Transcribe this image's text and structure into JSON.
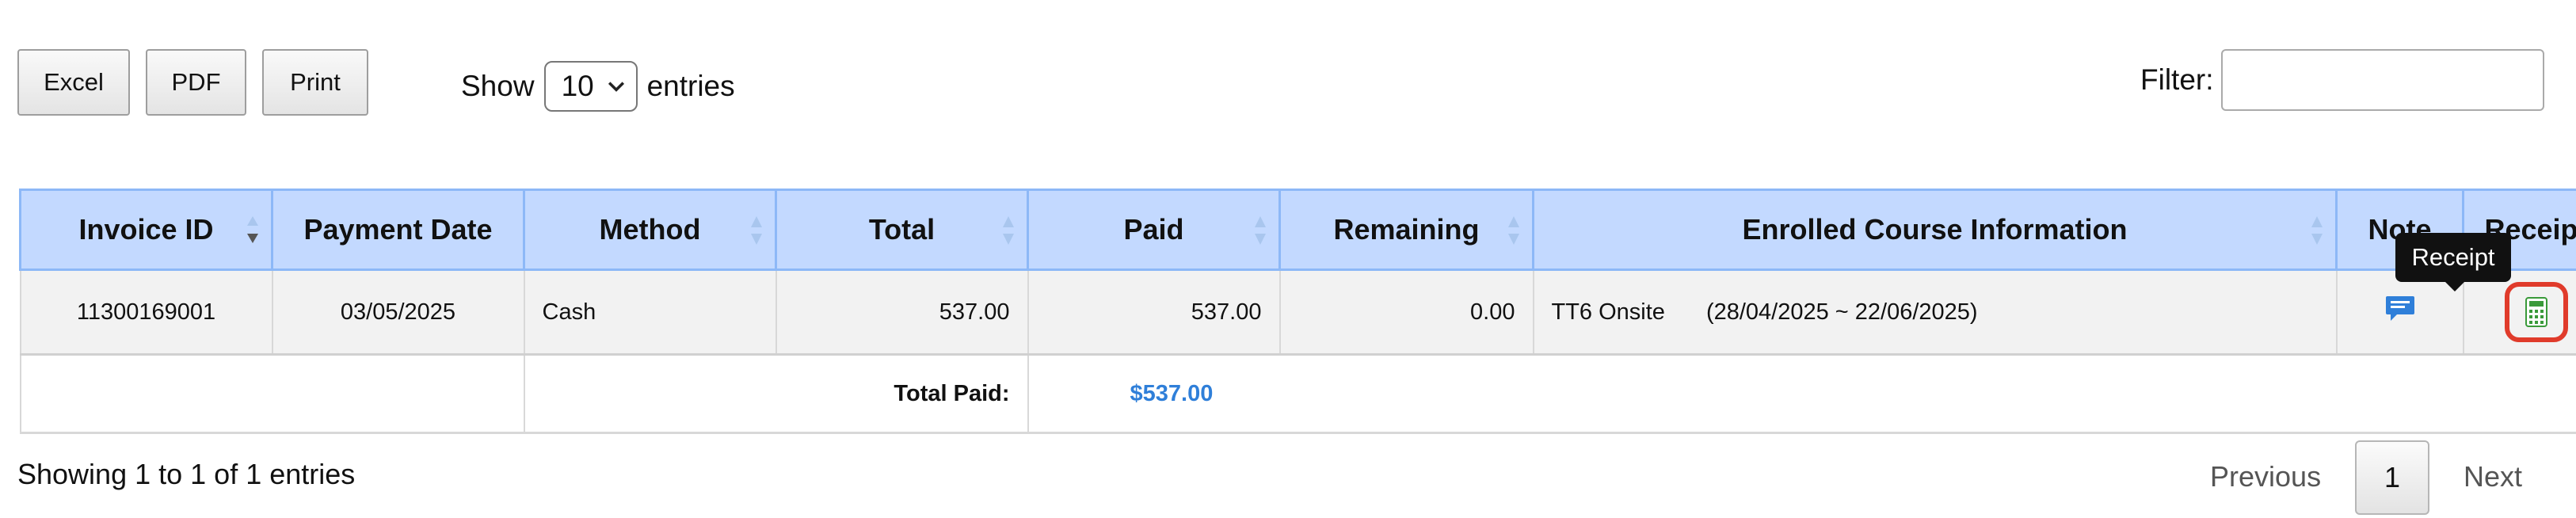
{
  "toolbar": {
    "excel_label": "Excel",
    "pdf_label": "PDF",
    "print_label": "Print"
  },
  "length_menu": {
    "show_label": "Show",
    "selected": "10",
    "entries_label": "entries"
  },
  "filter": {
    "label": "Filter:",
    "value": ""
  },
  "table": {
    "headers": [
      "Invoice ID",
      "Payment Date",
      "Method",
      "Total",
      "Paid",
      "Remaining",
      "Enrolled Course Information",
      "Note",
      "Receipt"
    ],
    "rows": [
      {
        "invoice_id": "11300169001",
        "payment_date": "03/05/2025",
        "method": "Cash",
        "total": "537.00",
        "paid": "537.00",
        "remaining": "0.00",
        "course_name": "TT6 Onsite",
        "course_dates": "(28/04/2025 ~ 22/06/2025)",
        "note_icon": "chat-note-icon",
        "receipt_icon": "calculator-receipt-icon"
      }
    ],
    "footer": {
      "total_paid_label": "Total Paid:",
      "total_paid_value": "$537.00"
    }
  },
  "tooltip": {
    "text": "Receipt"
  },
  "info": "Showing 1 to 1 of 1 entries",
  "pagination": {
    "previous": "Previous",
    "current": "1",
    "next": "Next"
  },
  "colors": {
    "header_bg": "#c3d9ff",
    "header_border": "#8db8f7",
    "link_blue": "#2f7fd9",
    "highlight_red": "#e03b2b",
    "receipt_green": "#3a9a3a",
    "note_blue": "#2f7fd9"
  }
}
